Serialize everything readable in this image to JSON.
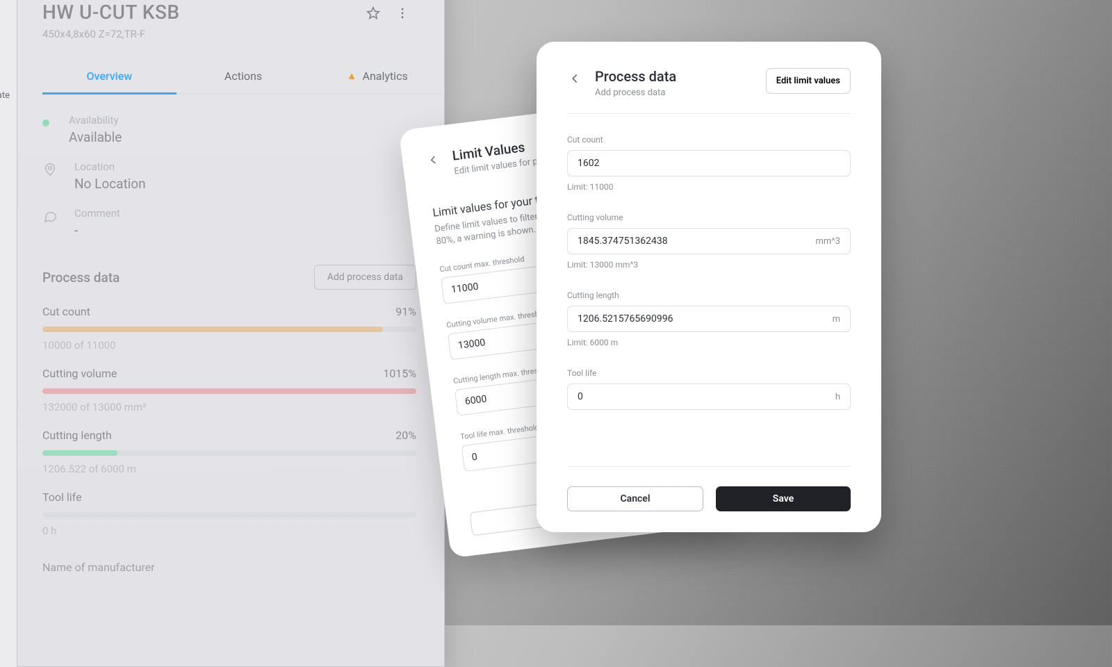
{
  "sliver": {
    "label": "ate"
  },
  "detail": {
    "title": "HW U-CUT KSB",
    "subtitle": "450x4,8x60 Z=72,TR-F",
    "tabs": {
      "overview": "Overview",
      "actions": "Actions",
      "analytics": "Analytics"
    },
    "availability": {
      "label": "Availability",
      "value": "Available"
    },
    "location": {
      "label": "Location",
      "value": "No Location"
    },
    "comment": {
      "label": "Comment",
      "value": "-"
    },
    "process_section_title": "Process data",
    "add_process_btn": "Add process data",
    "metrics": {
      "cut_count": {
        "name": "Cut count",
        "pct": "91%",
        "detail": "10000 of 11000",
        "fill": 91,
        "color": "#e0a24b"
      },
      "cut_volume": {
        "name": "Cutting volume",
        "pct": "1015%",
        "detail": "132000 of 13000 mm³",
        "fill": 100,
        "color": "#e57373"
      },
      "cut_length": {
        "name": "Cutting length",
        "pct": "20%",
        "detail": "1206.522 of 6000 m",
        "fill": 20,
        "color": "#4ad38a"
      },
      "tool_life": {
        "name": "Tool life",
        "pct": "",
        "detail": "0 h",
        "fill": 0,
        "color": "#cfd1d7"
      }
    },
    "manufacturer_label": "Name of manufacturer"
  },
  "back_card": {
    "title": "Limit Values",
    "subtitle": "Edit limit values for process data",
    "desc_title": "Limit values for your tool",
    "desc": "Define limit values to filter the status bars up to 100%. From 80%, a warning is shown.",
    "fields": {
      "cut_count": {
        "label": "Cut count max. threshold",
        "value": "11000"
      },
      "cut_volume": {
        "label": "Cutting volume max. threshold",
        "value": "13000"
      },
      "cut_length": {
        "label": "Cutting length max. threshold",
        "value": "6000"
      },
      "tool_life": {
        "label": "Tool life max. threshold",
        "value": "0"
      }
    }
  },
  "front_card": {
    "title": "Process data",
    "subtitle": "Add process data",
    "edit_btn": "Edit limit values",
    "fields": {
      "cut_count": {
        "label": "Cut count",
        "value": "1602",
        "unit": "",
        "hint": "Limit: 11000"
      },
      "cut_volume": {
        "label": "Cutting volume",
        "value": "1845.374751362438",
        "unit": "mm^3",
        "hint": "Limit: 13000 mm^3"
      },
      "cut_length": {
        "label": "Cutting length",
        "value": "1206.5215765690996",
        "unit": "m",
        "hint": "Limit: 6000 m"
      },
      "tool_life": {
        "label": "Tool life",
        "value": "0",
        "unit": "h",
        "hint": ""
      }
    },
    "cancel": "Cancel",
    "save": "Save"
  }
}
